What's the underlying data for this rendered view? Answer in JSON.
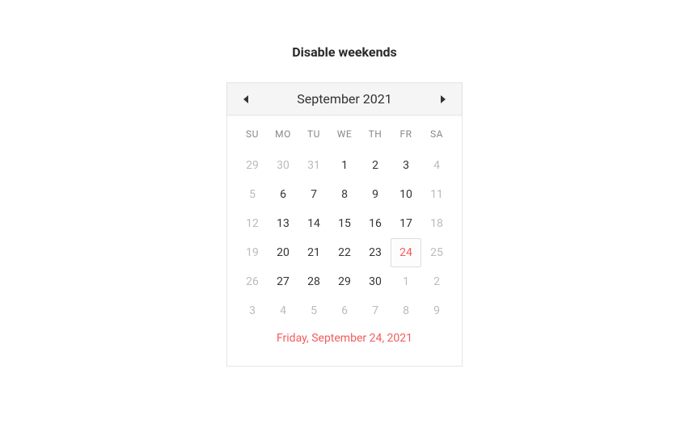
{
  "title": "Disable weekends",
  "header": {
    "month_label": "September 2021"
  },
  "weekdays": [
    "SU",
    "MO",
    "TU",
    "WE",
    "TH",
    "FR",
    "SA"
  ],
  "days": [
    {
      "num": "29",
      "other": true,
      "disabled": true
    },
    {
      "num": "30",
      "other": true
    },
    {
      "num": "31",
      "other": true
    },
    {
      "num": "1"
    },
    {
      "num": "2"
    },
    {
      "num": "3"
    },
    {
      "num": "4",
      "disabled": true
    },
    {
      "num": "5",
      "disabled": true
    },
    {
      "num": "6"
    },
    {
      "num": "7"
    },
    {
      "num": "8"
    },
    {
      "num": "9"
    },
    {
      "num": "10"
    },
    {
      "num": "11",
      "disabled": true
    },
    {
      "num": "12",
      "disabled": true
    },
    {
      "num": "13"
    },
    {
      "num": "14"
    },
    {
      "num": "15"
    },
    {
      "num": "16"
    },
    {
      "num": "17"
    },
    {
      "num": "18",
      "disabled": true
    },
    {
      "num": "19",
      "disabled": true
    },
    {
      "num": "20"
    },
    {
      "num": "21"
    },
    {
      "num": "22"
    },
    {
      "num": "23"
    },
    {
      "num": "24",
      "selected": true
    },
    {
      "num": "25",
      "disabled": true
    },
    {
      "num": "26",
      "disabled": true
    },
    {
      "num": "27"
    },
    {
      "num": "28"
    },
    {
      "num": "29"
    },
    {
      "num": "30"
    },
    {
      "num": "1",
      "other": true
    },
    {
      "num": "2",
      "other": true,
      "disabled": true
    },
    {
      "num": "3",
      "other": true,
      "disabled": true
    },
    {
      "num": "4",
      "other": true
    },
    {
      "num": "5",
      "other": true
    },
    {
      "num": "6",
      "other": true
    },
    {
      "num": "7",
      "other": true
    },
    {
      "num": "8",
      "other": true
    },
    {
      "num": "9",
      "other": true,
      "disabled": true
    }
  ],
  "selected_date_label": "Friday, September 24, 2021",
  "colors": {
    "accent": "#f45b5b"
  }
}
